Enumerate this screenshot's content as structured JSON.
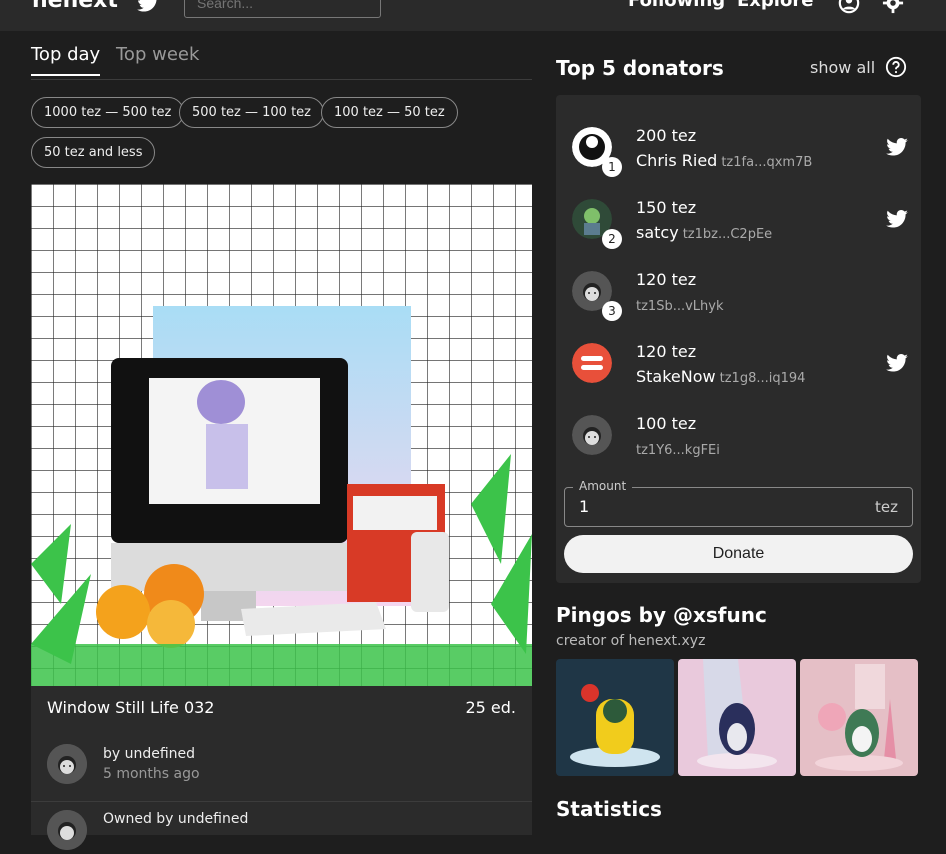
{
  "header": {
    "logo": "henext",
    "search_placeholder": "Search...",
    "nav": [
      "Following",
      "Explore"
    ]
  },
  "tabs": [
    {
      "label": "Top day",
      "active": true
    },
    {
      "label": "Top week",
      "active": false
    }
  ],
  "filters": [
    "1000 tez — 500 tez",
    "500 tez — 100 tez",
    "100 tez — 50 tez",
    "50 tez and less"
  ],
  "artwork": {
    "title": "Window Still Life 032",
    "editions": "25 ed.",
    "creator_line": "by undefined",
    "time_ago": "5 months ago",
    "owner_line": "Owned by undefined"
  },
  "donators": {
    "title": "Top 5 donators",
    "show_all": "show all",
    "list": [
      {
        "rank": "1",
        "amount": "200 tez",
        "name": "Chris Ried",
        "address": "tz1fa...qxm7B",
        "twitter": true
      },
      {
        "rank": "2",
        "amount": "150 tez",
        "name": "satcy",
        "address": "tz1bz...C2pEe",
        "twitter": true
      },
      {
        "rank": "3",
        "amount": "120 tez",
        "name": "",
        "address": "tz1Sb...vLhyk",
        "twitter": false
      },
      {
        "rank": "",
        "amount": "120 tez",
        "name": "StakeNow",
        "address": "tz1g8...iq194",
        "twitter": true
      },
      {
        "rank": "",
        "amount": "100 tez",
        "name": "",
        "address": "tz1Y6...kgFEi",
        "twitter": false
      }
    ],
    "amount_label": "Amount",
    "amount_value": "1",
    "amount_unit": "tez",
    "donate_label": "Donate"
  },
  "creator": {
    "title": "Pingos by @xsfunc",
    "subtitle": "creator of henext.xyz"
  },
  "statistics": {
    "title": "Statistics"
  },
  "colors": {
    "background": "#1e1e1e",
    "panel": "#2b2b2b",
    "topbar": "#2a2a2a",
    "stakenow": "#e8503a"
  }
}
